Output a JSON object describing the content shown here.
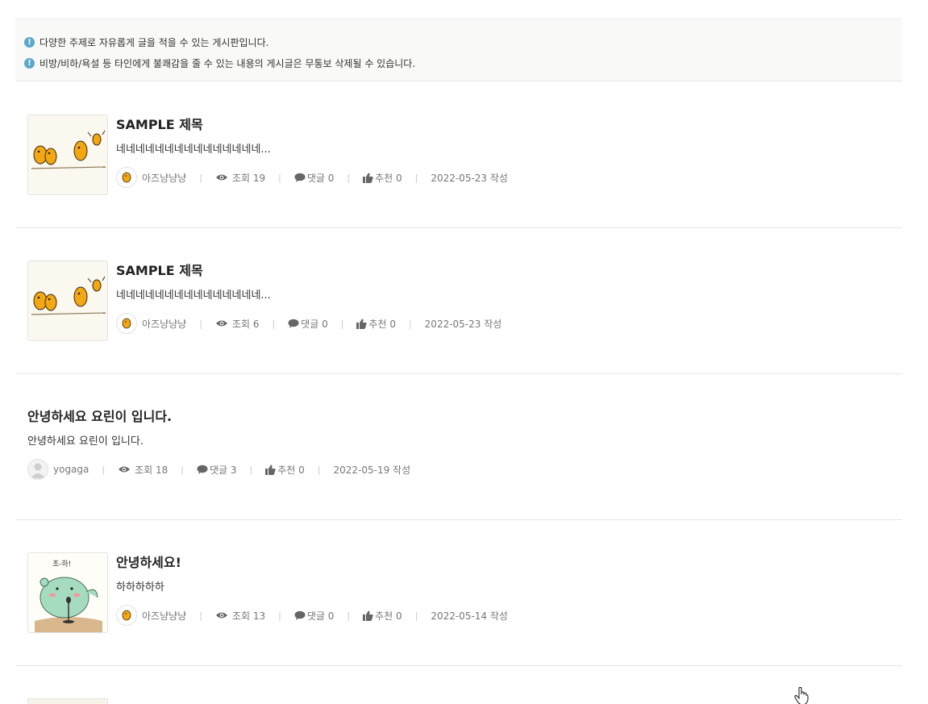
{
  "notices": [
    "다양한 주제로 자유롭게 글을 적을 수 있는 게시판입니다.",
    "비방/비하/욕설 등 타인에게 불쾌감을 줄 수 있는 내용의 게시글은 무통보 삭제될 수 있습니다."
  ],
  "notice_icon": "info-icon",
  "posts": [
    {
      "title": "SAMPLE 제목",
      "excerpt": "네네네네네네네네네네네네네네네...",
      "author": "아즈냥냥냥",
      "views": "조회 19",
      "comments": "댓글 0",
      "likes": "추천 0",
      "date": "2022-05-23 작성",
      "thumbnail": "birds-illustration"
    },
    {
      "title": "SAMPLE 제목",
      "excerpt": "네네네네네네네네네네네네네네네...",
      "author": "아즈냥냥냥",
      "views": "조회 6",
      "comments": "댓글 0",
      "likes": "추천 0",
      "date": "2022-05-23 작성",
      "thumbnail": "birds-illustration"
    },
    {
      "title": "안녕하세요 요린이 입니다.",
      "excerpt": "안녕하세요 요린이 입니다.",
      "author": "yogaga",
      "views": "조회 18",
      "comments": "댓글 3",
      "likes": "추천 0",
      "date": "2022-05-19 작성",
      "thumbnail": ""
    },
    {
      "title": "안녕하세요!",
      "excerpt": "하하하하하",
      "author": "아즈냥냥냥",
      "views": "조회 13",
      "comments": "댓글 0",
      "likes": "추천 0",
      "date": "2022-05-14 작성",
      "thumbnail": "dino-microphone-illustration",
      "thumbnail_text": "초-하!"
    }
  ],
  "colors": {
    "notice_bg": "#f9f9f7",
    "notice_icon": "#5ba8c9",
    "meta_text": "#777777",
    "divider": "#e6e6e6"
  }
}
